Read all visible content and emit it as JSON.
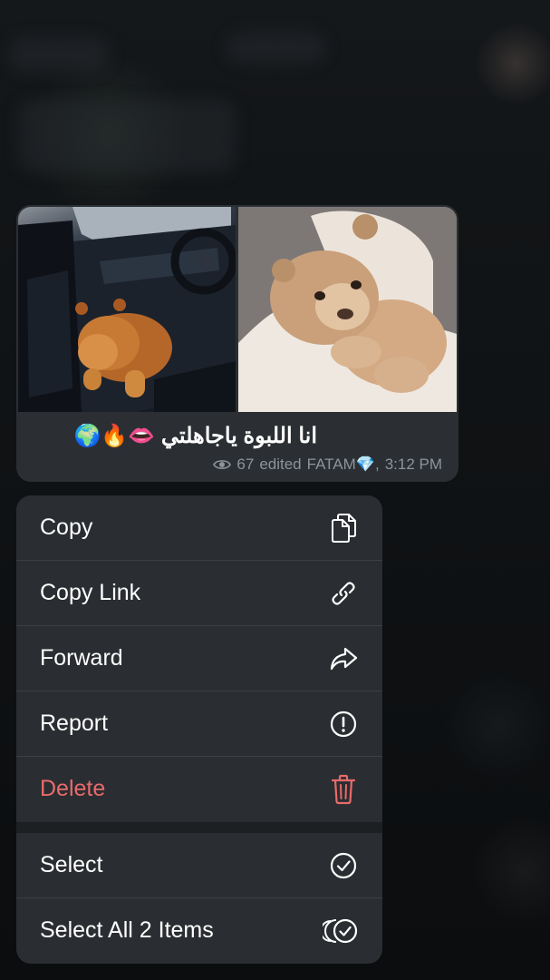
{
  "message": {
    "caption": "انا اللبوة ياجاهلتي 👄🔥🌍",
    "views": "67",
    "edited_label": "edited",
    "author": "FATAM💎,",
    "time": "3:12 PM",
    "photos": [
      {
        "subject": "lion cub in car seat"
      },
      {
        "subject": "lion cub on fluffy blanket"
      }
    ]
  },
  "menu": {
    "items": [
      {
        "label": "Copy",
        "icon": "copy-icon",
        "danger": false
      },
      {
        "label": "Copy Link",
        "icon": "link-icon",
        "danger": false
      },
      {
        "label": "Forward",
        "icon": "forward-icon",
        "danger": false
      },
      {
        "label": "Report",
        "icon": "report-icon",
        "danger": false
      },
      {
        "label": "Delete",
        "icon": "trash-icon",
        "danger": true
      }
    ],
    "secondary_items": [
      {
        "label": "Select",
        "icon": "check-circle-icon"
      },
      {
        "label": "Select All 2 Items",
        "icon": "select-all-icon"
      }
    ]
  },
  "colors": {
    "menu_bg": "#2a2d31",
    "danger": "#e86b6b",
    "meta_text": "#8c939a",
    "bubble_bg": "#2b2f33"
  }
}
